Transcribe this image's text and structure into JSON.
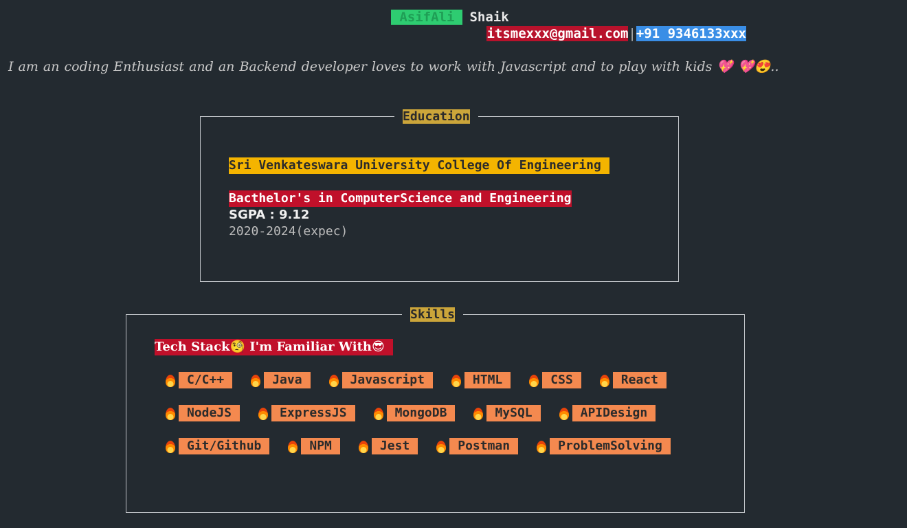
{
  "header": {
    "first_name": "AsifAli",
    "last_name": "Shaik",
    "email": "itsmexxx@gmail.com",
    "separator": "|",
    "phone": "+91 9346133xxx"
  },
  "bio": {
    "text": "I am an coding Enthusiast and an Backend developer loves to work with Javascript and to play with kids 💖 💖😍.."
  },
  "education": {
    "legend": "Education",
    "college": "Sri Venkateswara University College Of Engineering",
    "degree": "Bacthelor's in ComputerScience and Engineering",
    "sgpa": "SGPA : 9.12",
    "years": "2020-2024(expec)"
  },
  "skills": {
    "legend": "Skills",
    "heading_part1": "Tech Stack",
    "heading_emoji1": "🧐",
    "heading_part2": " I'm Familiar With",
    "heading_emoji2": "😎",
    "rows": [
      [
        "C/C++",
        "Java",
        "Javascript",
        "HTML",
        "CSS",
        "React"
      ],
      [
        "NodeJS",
        "ExpressJS",
        "MongoDB",
        "MySQL",
        "APIDesign"
      ],
      [
        "Git/Github",
        "NPM",
        "Jest",
        "Postman",
        "ProblemSolving"
      ]
    ],
    "item_icon": "fire-icon"
  },
  "colors": {
    "background": "#232a30",
    "first_name_bg": "#2ecc71",
    "email_bg": "#b8122c",
    "phone_bg": "#3a8ee6",
    "legend_bg": "#cba53a",
    "college_bg": "#f4b400",
    "degree_bg": "#c0102a",
    "skill_bg": "#f4894f"
  }
}
